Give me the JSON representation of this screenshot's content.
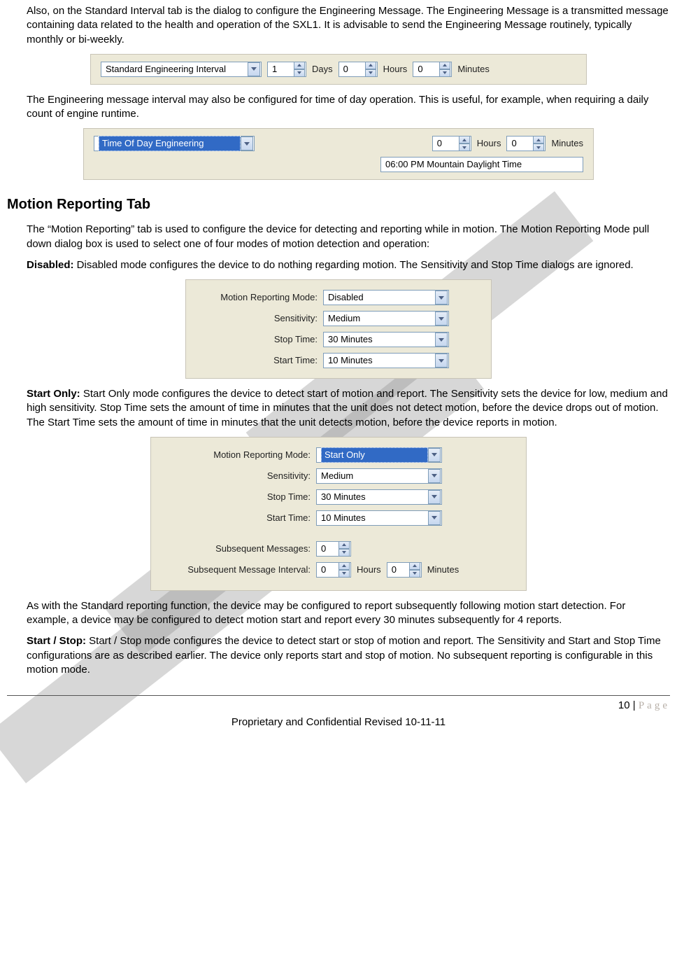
{
  "para1": "Also, on the Standard Interval tab is the dialog to configure the Engineering Message. The Engineering Message is a transmitted message containing data related to the health and operation of the SXL1.  It is advisable to send the Engineering Message routinely, typically monthly or bi-weekly.",
  "fig1": {
    "combo": "Standard Engineering Interval",
    "days_val": "1",
    "days_lbl": "Days",
    "hours_val": "0",
    "hours_lbl": "Hours",
    "mins_val": "0",
    "mins_lbl": "Minutes"
  },
  "para2": "The Engineering message interval may also be configured for time of day operation.  This is useful, for example, when requiring a daily count of engine runtime.",
  "fig2": {
    "combo": "Time Of Day Engineering",
    "hours_val": "0",
    "hours_lbl": "Hours",
    "mins_val": "0",
    "mins_lbl": "Minutes",
    "tz": "06:00 PM Mountain Daylight Time"
  },
  "heading": "Motion Reporting Tab",
  "para3": "The “Motion Reporting” tab is used to configure the device for detecting and reporting while in motion.  The Motion Reporting Mode pull down dialog box is used to select one of four modes of motion detection and operation:",
  "disabled_label": "Disabled:",
  "para4": "  Disabled mode configures the device to do nothing regarding motion.  The Sensitivity and Stop Time dialogs are ignored.",
  "fig3": {
    "mode_lbl": "Motion Reporting Mode:",
    "mode_val": "Disabled",
    "sens_lbl": "Sensitivity:",
    "sens_val": "Medium",
    "stop_lbl": "Stop Time:",
    "stop_val": "30 Minutes",
    "start_lbl": "Start Time:",
    "start_val": "10 Minutes"
  },
  "startonly_label": "Start Only:",
  "para5": "  Start Only mode configures the device to detect start of motion and report.  The Sensitivity sets the device for low, medium and high sensitivity. Stop Time sets the amount of time in minutes that the unit does not detect motion, before the device drops out of motion.  The Start Time sets the amount of time in minutes that the unit detects motion, before the device reports in motion.",
  "fig4": {
    "mode_lbl": "Motion Reporting Mode:",
    "mode_val": "Start Only",
    "sens_lbl": "Sensitivity:",
    "sens_val": "Medium",
    "stop_lbl": "Stop Time:",
    "stop_val": "30 Minutes",
    "start_lbl": "Start Time:",
    "start_val": "10 Minutes",
    "subm_lbl": "Subsequent Messages:",
    "subm_val": "0",
    "subi_lbl": "Subsequent Message Interval:",
    "subi_h_val": "0",
    "subi_h_lbl": "Hours",
    "subi_m_val": "0",
    "subi_m_lbl": "Minutes"
  },
  "para6": "As with the Standard reporting function, the device may be configured to report subsequently following motion start detection.  For example, a device may be configured to detect motion start and report every 30 minutes subsequently for 4 reports.",
  "startstop_label": "Start / Stop:",
  "para7": "  Start / Stop mode configures the device to detect start or stop of motion and report.  The Sensitivity and Start and Stop Time configurations are as described earlier. The device only reports start and stop of motion. No subsequent reporting is configurable in this motion mode.",
  "footer": {
    "pagenum": "10",
    "sep": " | ",
    "pagelabel": "Page",
    "center": "Proprietary and Confidential Revised 10-11-11"
  }
}
